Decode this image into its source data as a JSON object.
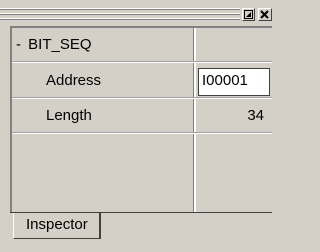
{
  "window": {
    "restore_icon": "restore-icon",
    "close_icon": "close-icon"
  },
  "inspector": {
    "group": {
      "expander": "-",
      "name": "BIT_SEQ"
    },
    "properties": [
      {
        "label": "Address",
        "value": "I00001"
      },
      {
        "label": "Length",
        "value": "34"
      }
    ]
  },
  "tabs": [
    {
      "label": "Inspector",
      "active": true
    }
  ]
}
